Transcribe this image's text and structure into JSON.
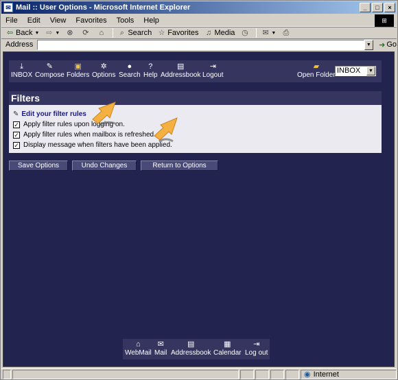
{
  "window": {
    "title": "Mail :: User Options - Microsoft Internet Explorer"
  },
  "menu": [
    "File",
    "Edit",
    "View",
    "Favorites",
    "Tools",
    "Help"
  ],
  "toolbar": {
    "back": "Back",
    "search": "Search",
    "favorites": "Favorites",
    "media": "Media"
  },
  "address": {
    "label": "Address",
    "value": "",
    "go": "Go"
  },
  "topnav": {
    "items": [
      "INBOX",
      "Compose",
      "Folders",
      "Options",
      "Search",
      "Help",
      "Addressbook",
      "Logout"
    ],
    "open_folder": "Open Folder",
    "folder_selected": "INBOX"
  },
  "filters": {
    "title": "Filters",
    "edit_link": "Edit your filter rules",
    "options": [
      {
        "label": "Apply filter rules upon logging on.",
        "checked": true
      },
      {
        "label": "Apply filter rules when mailbox is refreshed.",
        "checked": true
      },
      {
        "label": "Display message when filters have been applied.",
        "checked": true
      }
    ]
  },
  "buttons": {
    "save": "Save Options",
    "undo": "Undo Changes",
    "return": "Return to Options"
  },
  "bottomnav": {
    "items": [
      "WebMail",
      "Mail",
      "Addressbook",
      "Calendar",
      "Log out"
    ]
  },
  "status": {
    "text": "",
    "zone": "Internet"
  },
  "colors": {
    "background": "#232350",
    "panel": "#353560",
    "accent_arrow": "#f4b040"
  }
}
